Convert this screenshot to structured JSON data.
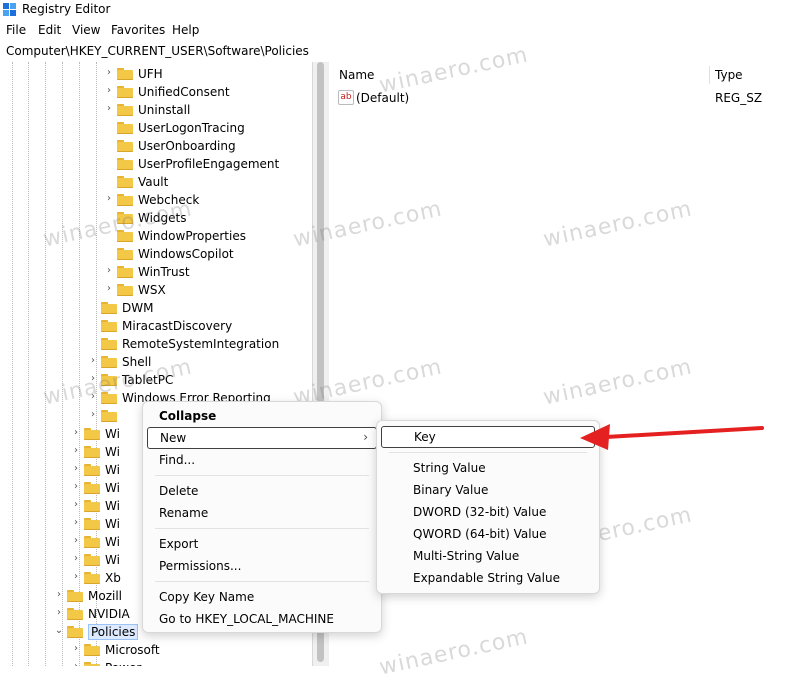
{
  "window": {
    "title": "Registry Editor"
  },
  "menu": [
    "File",
    "Edit",
    "View",
    "Favorites",
    "Help"
  ],
  "address": "Computer\\HKEY_CURRENT_USER\\Software\\Policies",
  "tree": [
    {
      "label": "UFH",
      "level": 2,
      "expander": true
    },
    {
      "label": "UnifiedConsent",
      "level": 2,
      "expander": true
    },
    {
      "label": "Uninstall",
      "level": 2,
      "expander": true
    },
    {
      "label": "UserLogonTracing",
      "level": 2,
      "expander": false
    },
    {
      "label": "UserOnboarding",
      "level": 2,
      "expander": false
    },
    {
      "label": "UserProfileEngagement",
      "level": 2,
      "expander": false
    },
    {
      "label": "Vault",
      "level": 2,
      "expander": false
    },
    {
      "label": "Webcheck",
      "level": 2,
      "expander": true
    },
    {
      "label": "Widgets",
      "level": 2,
      "expander": false
    },
    {
      "label": "WindowProperties",
      "level": 2,
      "expander": false
    },
    {
      "label": "WindowsCopilot",
      "level": 2,
      "expander": false
    },
    {
      "label": "WinTrust",
      "level": 2,
      "expander": true
    },
    {
      "label": "WSX",
      "level": 2,
      "expander": true
    },
    {
      "label": "DWM",
      "level": 1,
      "expander": false
    },
    {
      "label": "MiracastDiscovery",
      "level": 1,
      "expander": false
    },
    {
      "label": "RemoteSystemIntegration",
      "level": 1,
      "expander": false
    },
    {
      "label": "Shell",
      "level": 1,
      "expander": true
    },
    {
      "label": "TabletPC",
      "level": 1,
      "expander": true
    },
    {
      "label": "Windows Error Reporting",
      "level": 1,
      "expander": true
    },
    {
      "label": "",
      "level": 1,
      "expander": true
    },
    {
      "label": "Wi",
      "level": 0,
      "expander": true
    },
    {
      "label": "Wi",
      "level": 0,
      "expander": true
    },
    {
      "label": "Wi",
      "level": 0,
      "expander": true
    },
    {
      "label": "Wi",
      "level": 0,
      "expander": true
    },
    {
      "label": "Wi",
      "level": 0,
      "expander": true
    },
    {
      "label": "Wi",
      "level": 0,
      "expander": true
    },
    {
      "label": "Wi",
      "level": 0,
      "expander": true
    },
    {
      "label": "Wi",
      "level": 0,
      "expander": true
    },
    {
      "label": "Xb",
      "level": 0,
      "expander": true
    },
    {
      "label": "Mozill",
      "level": -1,
      "expander": true
    },
    {
      "label": "NVIDIA",
      "level": -1,
      "expander": true
    },
    {
      "label": "Policies",
      "level": -1,
      "expander": true,
      "expanded": true,
      "selected": true
    },
    {
      "label": "Microsoft",
      "level": 0,
      "expander": true
    },
    {
      "label": "Power",
      "level": 0,
      "expander": true
    }
  ],
  "list": {
    "columns": {
      "name": "Name",
      "type": "Type"
    },
    "rows": [
      {
        "icon": "ab",
        "name": "(Default)",
        "type": "REG_SZ"
      }
    ]
  },
  "context_menu": {
    "collapse": "Collapse",
    "new": "New",
    "find": "Find...",
    "delete": "Delete",
    "rename": "Rename",
    "export": "Export",
    "permissions": "Permissions...",
    "copy_key_name": "Copy Key Name",
    "goto_hklm": "Go to HKEY_LOCAL_MACHINE"
  },
  "submenu": {
    "key": "Key",
    "string_value": "String Value",
    "binary_value": "Binary Value",
    "dword_value": "DWORD (32-bit) Value",
    "qword_value": "QWORD (64-bit) Value",
    "multi_string_value": "Multi-String Value",
    "expandable_string_value": "Expandable String Value"
  },
  "watermark": "winaero.com",
  "colors": {
    "folder": "#f3c847",
    "arrow": "#e52020",
    "selection": "#ddeaff"
  }
}
